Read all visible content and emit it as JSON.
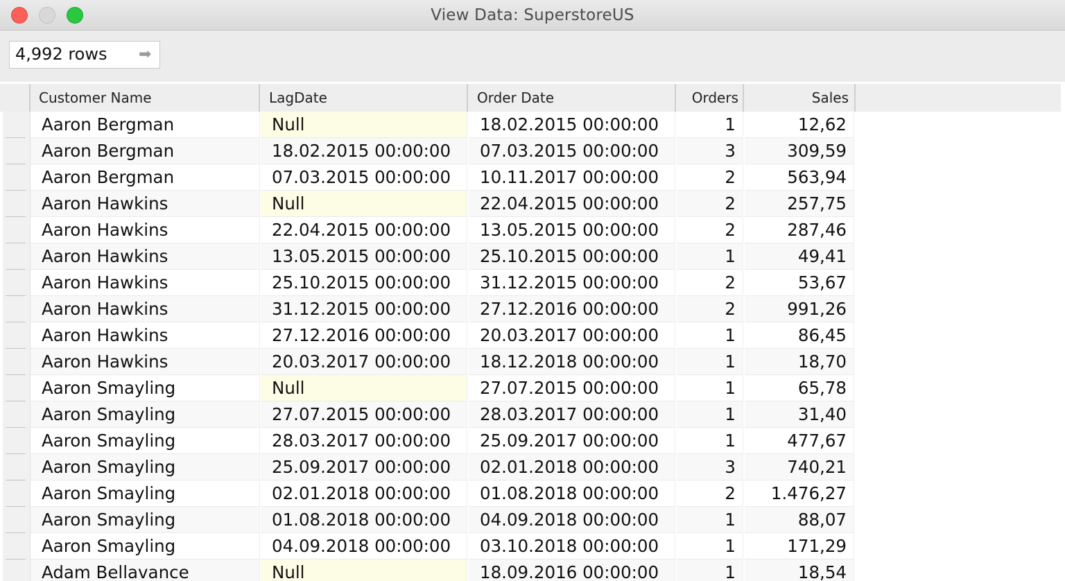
{
  "window": {
    "title": "View Data:  SuperstoreUS"
  },
  "toolbar": {
    "row_count": "4,992 rows",
    "arrow_icon": "arrow-right-icon"
  },
  "table": {
    "columns": [
      "Customer Name",
      "LagDate",
      "Order Date",
      "Orders",
      "Sales"
    ],
    "rows": [
      {
        "name": "Aaron Bergman",
        "lag": "Null",
        "order": "18.02.2015 00:00:00",
        "orders": "1",
        "sales": "12,62"
      },
      {
        "name": "Aaron Bergman",
        "lag": "18.02.2015 00:00:00",
        "order": "07.03.2015 00:00:00",
        "orders": "3",
        "sales": "309,59"
      },
      {
        "name": "Aaron Bergman",
        "lag": "07.03.2015 00:00:00",
        "order": "10.11.2017 00:00:00",
        "orders": "2",
        "sales": "563,94"
      },
      {
        "name": "Aaron Hawkins",
        "lag": "Null",
        "order": "22.04.2015 00:00:00",
        "orders": "2",
        "sales": "257,75"
      },
      {
        "name": "Aaron Hawkins",
        "lag": "22.04.2015 00:00:00",
        "order": "13.05.2015 00:00:00",
        "orders": "2",
        "sales": "287,46"
      },
      {
        "name": "Aaron Hawkins",
        "lag": "13.05.2015 00:00:00",
        "order": "25.10.2015 00:00:00",
        "orders": "1",
        "sales": "49,41"
      },
      {
        "name": "Aaron Hawkins",
        "lag": "25.10.2015 00:00:00",
        "order": "31.12.2015 00:00:00",
        "orders": "2",
        "sales": "53,67"
      },
      {
        "name": "Aaron Hawkins",
        "lag": "31.12.2015 00:00:00",
        "order": "27.12.2016 00:00:00",
        "orders": "2",
        "sales": "991,26"
      },
      {
        "name": "Aaron Hawkins",
        "lag": "27.12.2016 00:00:00",
        "order": "20.03.2017 00:00:00",
        "orders": "1",
        "sales": "86,45"
      },
      {
        "name": "Aaron Hawkins",
        "lag": "20.03.2017 00:00:00",
        "order": "18.12.2018 00:00:00",
        "orders": "1",
        "sales": "18,70"
      },
      {
        "name": "Aaron Smayling",
        "lag": "Null",
        "order": "27.07.2015 00:00:00",
        "orders": "1",
        "sales": "65,78"
      },
      {
        "name": "Aaron Smayling",
        "lag": "27.07.2015 00:00:00",
        "order": "28.03.2017 00:00:00",
        "orders": "1",
        "sales": "31,40"
      },
      {
        "name": "Aaron Smayling",
        "lag": "28.03.2017 00:00:00",
        "order": "25.09.2017 00:00:00",
        "orders": "1",
        "sales": "477,67"
      },
      {
        "name": "Aaron Smayling",
        "lag": "25.09.2017 00:00:00",
        "order": "02.01.2018 00:00:00",
        "orders": "3",
        "sales": "740,21"
      },
      {
        "name": "Aaron Smayling",
        "lag": "02.01.2018 00:00:00",
        "order": "01.08.2018 00:00:00",
        "orders": "2",
        "sales": "1.476,27"
      },
      {
        "name": "Aaron Smayling",
        "lag": "01.08.2018 00:00:00",
        "order": "04.09.2018 00:00:00",
        "orders": "1",
        "sales": "88,07"
      },
      {
        "name": "Aaron Smayling",
        "lag": "04.09.2018 00:00:00",
        "order": "03.10.2018 00:00:00",
        "orders": "1",
        "sales": "171,29"
      },
      {
        "name": "Adam Bellavance",
        "lag": "Null",
        "order": "18.09.2016 00:00:00",
        "orders": "1",
        "sales": "18,54"
      }
    ]
  },
  "colors": {
    "null_highlight": "#fdfde6",
    "close": "#fc5f57",
    "zoom": "#29c840"
  }
}
